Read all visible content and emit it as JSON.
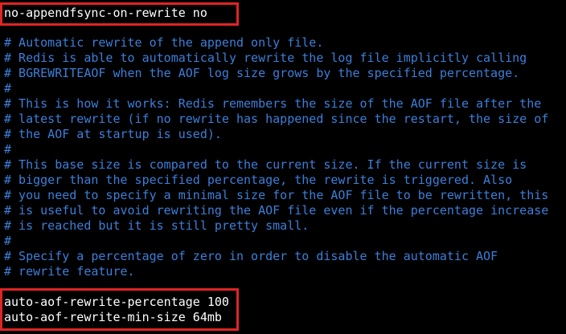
{
  "colors": {
    "background": "#000000",
    "text": "#ffffff",
    "comment": "#3c7fd9",
    "highlight_border": "#e02424"
  },
  "lines": [
    "no-appendfsync-on-rewrite no",
    "",
    "# Automatic rewrite of the append only file.",
    "# Redis is able to automatically rewrite the log file implicitly calling",
    "# BGREWRITEAOF when the AOF log size grows by the specified percentage.",
    "#",
    "# This is how it works: Redis remembers the size of the AOF file after the",
    "# latest rewrite (if no rewrite has happened since the restart, the size of",
    "# the AOF at startup is used).",
    "#",
    "# This base size is compared to the current size. If the current size is",
    "# bigger than the specified percentage, the rewrite is triggered. Also",
    "# you need to specify a minimal size for the AOF file to be rewritten, this",
    "# is useful to avoid rewriting the AOF file even if the percentage increase",
    "# is reached but it is still pretty small.",
    "#",
    "# Specify a percentage of zero in order to disable the automatic AOF",
    "# rewrite feature.",
    "",
    "auto-aof-rewrite-percentage 100",
    "auto-aof-rewrite-min-size 64mb"
  ]
}
